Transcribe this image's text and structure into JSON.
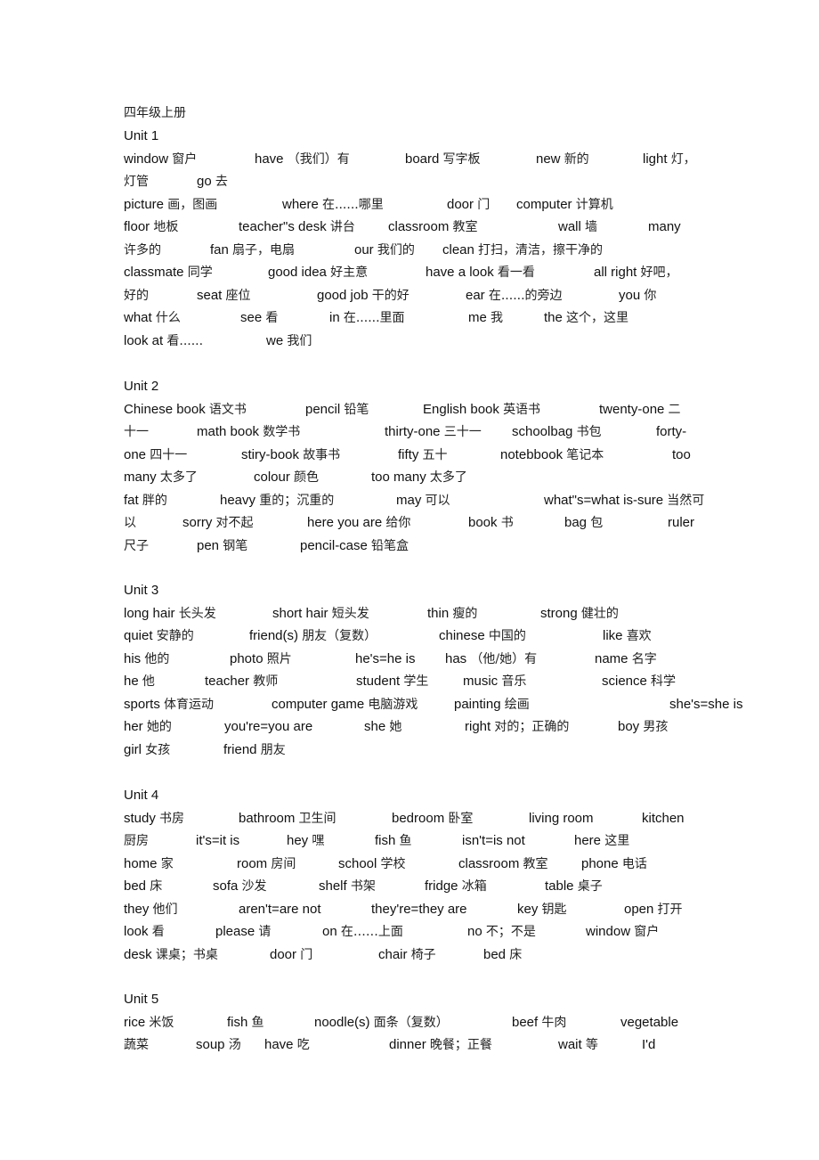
{
  "document": {
    "title": "四年级上册",
    "units": [
      {
        "heading": "Unit 1",
        "lines": [
          [
            "window 窗户",
            "have （我们）有",
            "board 写字板",
            "new 新的",
            "light 灯，"
          ],
          [
            "灯管",
            "go 去"
          ],
          [
            "picture 画，图画",
            "where 在......哪里",
            "door 门",
            "computer 计算机"
          ],
          [
            "floor 地板",
            "teacher\"s desk 讲台",
            "classroom 教室",
            "wall 墙",
            "many"
          ],
          [
            "许多的",
            "fan 扇子，电扇",
            "our 我们的",
            "clean 打扫，清洁，擦干净的"
          ],
          [
            "classmate 同学",
            "good idea 好主意",
            "have a look 看一看",
            "all right 好吧，"
          ],
          [
            "好的",
            "seat 座位",
            "good job 干的好",
            "ear 在......的旁边",
            "you 你"
          ],
          [
            "what 什么",
            "see 看",
            "in 在......里面",
            "me 我",
            "the 这个，这里"
          ],
          [
            "look at 看......",
            "we 我们"
          ]
        ]
      },
      {
        "heading": "Unit 2",
        "lines": [
          [
            "Chinese book 语文书",
            "pencil 铅笔",
            "English book 英语书",
            "twenty-one 二"
          ],
          [
            "十一",
            "math book 数学书",
            "thirty-one 三十一",
            "schoolbag 书包",
            "forty-"
          ],
          [
            "one 四十一",
            "stiry-book 故事书",
            "fifty 五十",
            "notebbook 笔记本",
            "too"
          ],
          [
            "many 太多了",
            "colour 颜色",
            "too many 太多了"
          ],
          [
            "fat 胖的",
            "heavy 重的；沉重的",
            "may 可以",
            "what\"s=what is-sure 当然可"
          ],
          [
            "以",
            "sorry 对不起",
            "here you are 给你",
            "book 书",
            "bag 包",
            "ruler"
          ],
          [
            "尺子",
            "pen 钢笔",
            "pencil-case 铅笔盒"
          ]
        ]
      },
      {
        "heading": "Unit 3",
        "lines": [
          [
            "long hair 长头发",
            "short hair 短头发",
            "thin 瘦的",
            "strong 健壮的"
          ],
          [
            "quiet 安静的",
            "friend(s) 朋友（复数）",
            "chinese 中国的",
            "like 喜欢"
          ],
          [
            "his 他的",
            "photo 照片",
            "he's=he is",
            "has （他/她）有",
            "name 名字"
          ],
          [
            "he 他",
            "teacher 教师",
            "student 学生",
            "music 音乐",
            "science 科学"
          ],
          [
            "sports 体育运动",
            "computer game 电脑游戏",
            "painting 绘画",
            "she's=she is"
          ],
          [
            "her 她的",
            "you're=you are",
            "she 她",
            "right 对的；正确的",
            "boy 男孩"
          ],
          [
            "girl 女孩",
            "friend 朋友"
          ]
        ]
      },
      {
        "heading": "Unit 4",
        "lines": [
          [
            "study 书房",
            "bathroom 卫生间",
            "bedroom 卧室",
            "living room",
            "kitchen"
          ],
          [
            "厨房",
            "it's=it is",
            "hey 嘿",
            "fish 鱼",
            "isn't=is not",
            "here 这里"
          ],
          [
            "home 家",
            "room 房间",
            "school 学校",
            "classroom 教室",
            "phone 电话"
          ],
          [
            "bed 床",
            "sofa 沙发",
            "shelf 书架",
            "fridge 冰箱",
            "table 桌子"
          ],
          [
            "they 他们",
            "aren't=are not",
            "they're=they are",
            "key 钥匙",
            "open 打开"
          ],
          [
            "look 看",
            "please 请",
            "on 在……上面",
            "no 不；不是",
            "window 窗户"
          ],
          [
            "desk 课桌；书桌",
            "door 门",
            "chair 椅子",
            "bed 床"
          ]
        ]
      },
      {
        "heading": "Unit 5",
        "lines": [
          [
            "rice 米饭",
            "fish 鱼",
            "noodle(s) 面条（复数）",
            "beef 牛肉",
            "vegetable"
          ],
          [
            "蔬菜",
            "soup 汤",
            "have 吃",
            "dinner 晚餐；正餐",
            "wait 等",
            "I'd"
          ]
        ]
      }
    ]
  }
}
